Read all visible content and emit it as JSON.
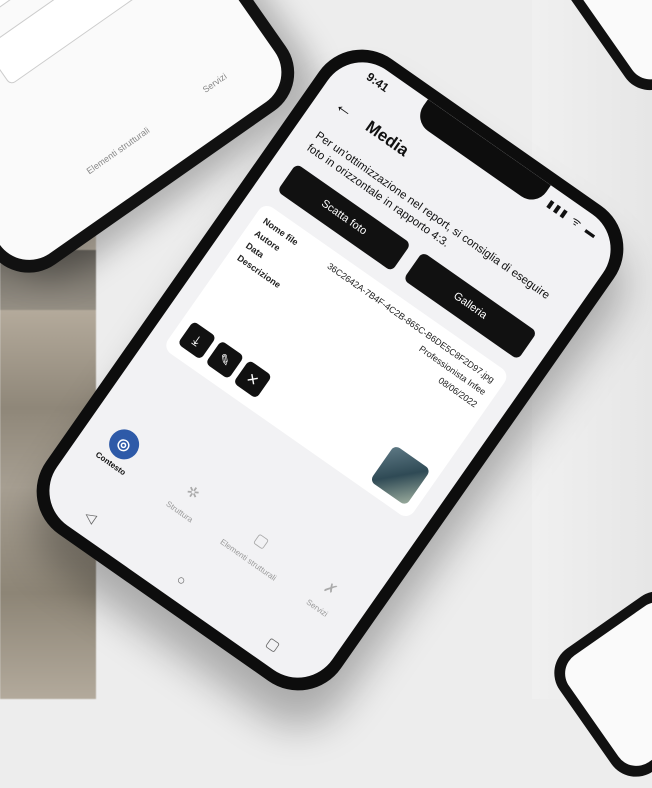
{
  "screen": {
    "time": "9:41",
    "status_icons": "▮▮▮ ᯤ ▬",
    "title": "Media",
    "back_icon": "←",
    "hint": "Per un'ottimizzazione nel report, si consiglia di eseguire foto in orizzontale in rapporto 4:3.",
    "actions": {
      "take_photo": "Scatta foto",
      "gallery": "Galleria"
    },
    "media_item": {
      "labels": {
        "file_name": "Nome file",
        "author": "Autore",
        "date": "Data",
        "description": "Descrizione"
      },
      "file_name": "36C2642A-7B4F-4C2B-865C-B6DE5C8F2D97.jpg",
      "author": "Professionista Infee",
      "date": "08/06/2022",
      "description": "",
      "icons": {
        "download": "⤓",
        "edit": "✎",
        "delete": "✕"
      }
    },
    "tabs": [
      {
        "label": "Contesto",
        "icon": "◎",
        "active": true
      },
      {
        "label": "Struttura",
        "icon": "✲",
        "active": false
      },
      {
        "label": "Elementi strutturali",
        "icon": "▢",
        "active": false
      },
      {
        "label": "Servizi",
        "icon": "✗",
        "active": false
      }
    ],
    "system_nav": {
      "back": "◁",
      "home": "○",
      "recents": "▢"
    }
  },
  "left_phone": {
    "tabs": [
      "Elementi strutturali",
      "Servizi"
    ]
  }
}
